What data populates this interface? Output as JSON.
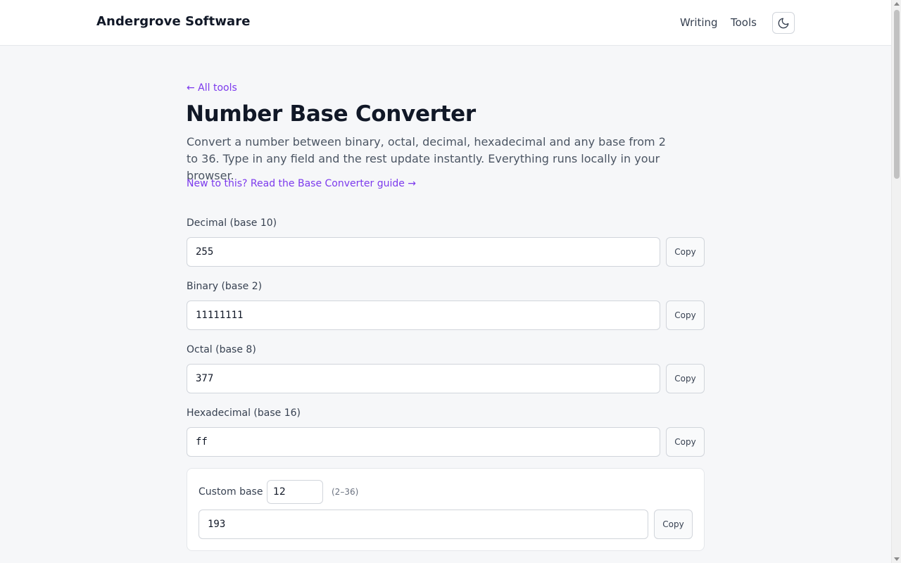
{
  "header": {
    "brand": "Andergrove Software",
    "nav": [
      {
        "label": "Writing"
      },
      {
        "label": "Tools"
      }
    ],
    "theme_toggle_icon": "moon-icon"
  },
  "main": {
    "back_link": "← All tools",
    "title": "Number Base Converter",
    "description": "Convert a number between binary, octal, decimal, hexadecimal and any base from 2 to 36. Type in any field and the rest update instantly. Everything runs locally in your browser.",
    "guide_link": "New to this? Read the Base Converter guide →",
    "fields": [
      {
        "label": "Decimal (base 10)",
        "value": "255",
        "copy_label": "Copy"
      },
      {
        "label": "Binary (base 2)",
        "value": "11111111",
        "copy_label": "Copy"
      },
      {
        "label": "Octal (base 8)",
        "value": "377",
        "copy_label": "Copy"
      },
      {
        "label": "Hexadecimal (base 16)",
        "value": "ff",
        "copy_label": "Copy"
      }
    ],
    "custom": {
      "label": "Custom base",
      "base_value": "12",
      "range_hint": "(2–36)",
      "value": "193",
      "copy_label": "Copy"
    }
  },
  "colors": {
    "accent": "#7c3aed",
    "background": "#f6f7f9",
    "text": "#111827"
  }
}
